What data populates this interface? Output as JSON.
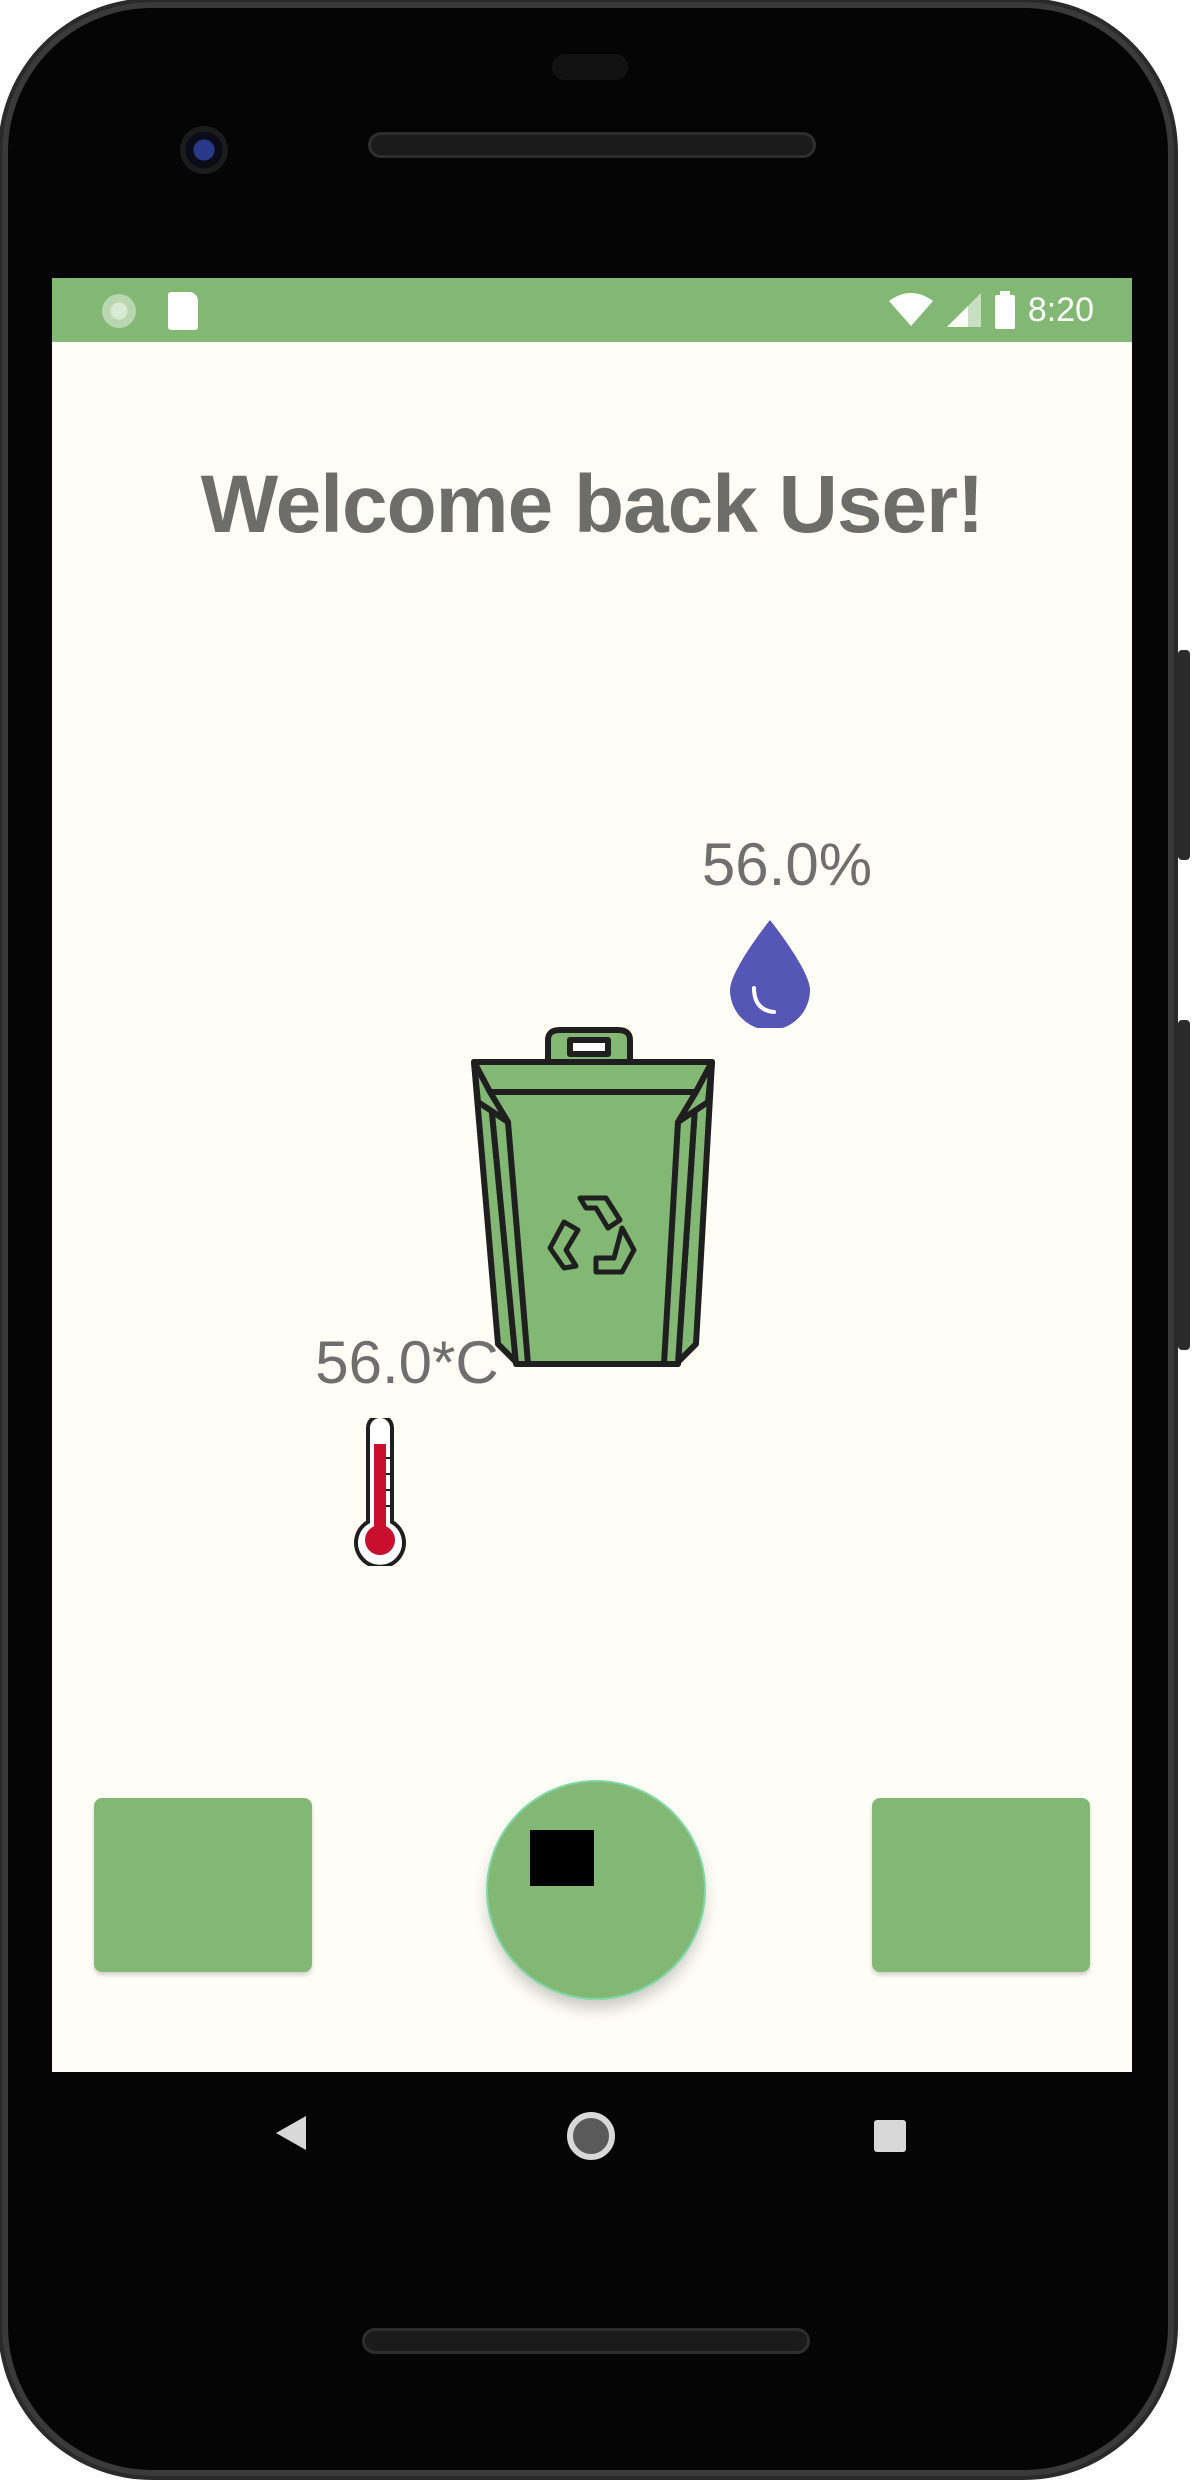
{
  "status_bar": {
    "time": "8:20",
    "left_icons": [
      "sync-icon",
      "sd-card-icon"
    ],
    "right_icons": [
      "wifi-icon",
      "signal-icon",
      "battery-icon"
    ]
  },
  "main": {
    "welcome": "Welcome back User!",
    "humidity": "56.0%",
    "temperature": "56.0*C",
    "icons": {
      "humidity": "water-drop-icon",
      "bin": "recycle-bin-icon",
      "temperature": "thermometer-icon"
    }
  },
  "bottom_bar": {
    "left_button_label": "",
    "right_button_label": "",
    "center_button_icon": "stop-icon"
  },
  "system_nav": [
    "back-icon",
    "home-icon",
    "recents-icon"
  ],
  "colors": {
    "accent_green": "#82b874",
    "background": "#fefef6",
    "text_gray": "#6d6d6a",
    "drop_blue": "#5556b5",
    "thermo_red": "#c8102e"
  }
}
